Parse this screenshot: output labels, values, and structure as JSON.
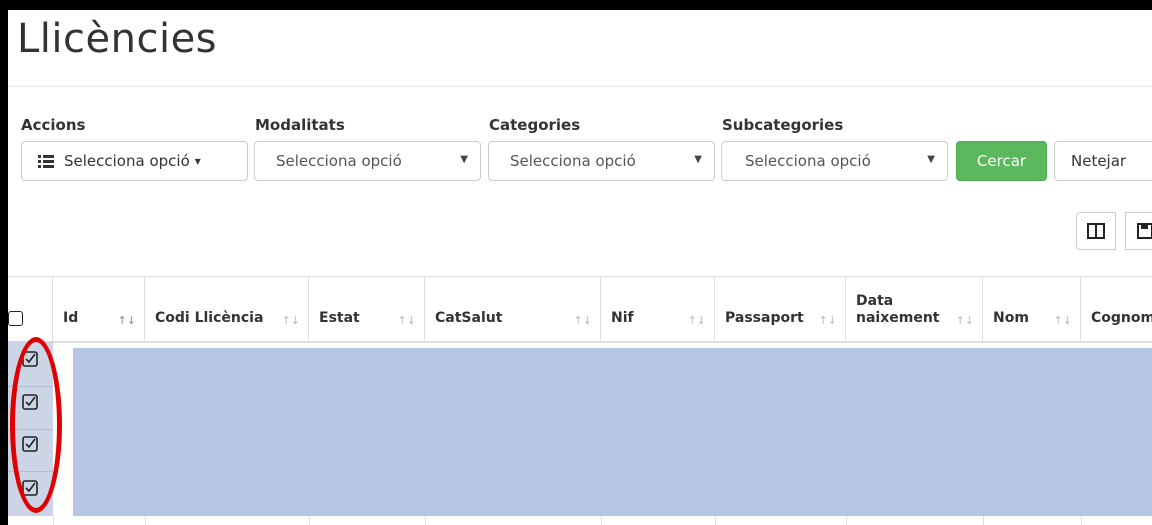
{
  "page": {
    "title": "Llicències"
  },
  "filters": [
    {
      "key": "accions",
      "label": "Accions",
      "value": "Selecciona opció",
      "caret": "▾"
    },
    {
      "key": "modalitats",
      "label": "Modalitats",
      "value": "Selecciona opció",
      "arrow": "▼"
    },
    {
      "key": "categories",
      "label": "Categories",
      "value": "Selecciona opció",
      "arrow": "▼"
    },
    {
      "key": "subcategories",
      "label": "Subcategories",
      "value": "Selecciona opció",
      "arrow": "▼"
    }
  ],
  "buttons": {
    "search": "Cercar",
    "clear": "Netejar"
  },
  "toolbar": {
    "icons": [
      "columns-icon",
      "save-icon"
    ]
  },
  "table": {
    "columns": [
      {
        "label": "Id",
        "sort": "↑↓"
      },
      {
        "label": "Codi Llicència",
        "sort": "↑↓"
      },
      {
        "label": "Estat",
        "sort": "↑↓"
      },
      {
        "label": "CatSalut",
        "sort": "↑↓"
      },
      {
        "label": "Nif",
        "sort": "↑↓"
      },
      {
        "label": "Passaport",
        "sort": "↑↓"
      },
      {
        "label": "Data naixement",
        "sort": "↑↓"
      },
      {
        "label": "Nom",
        "sort": "↑↓"
      },
      {
        "label": "Cognom",
        "sort": ""
      }
    ],
    "rows_checked": [
      true,
      true,
      true,
      true
    ]
  },
  "colors": {
    "accent_green": "#5cb85c",
    "selection": "#b4c6e4",
    "highlight_oval": "#e00000"
  }
}
